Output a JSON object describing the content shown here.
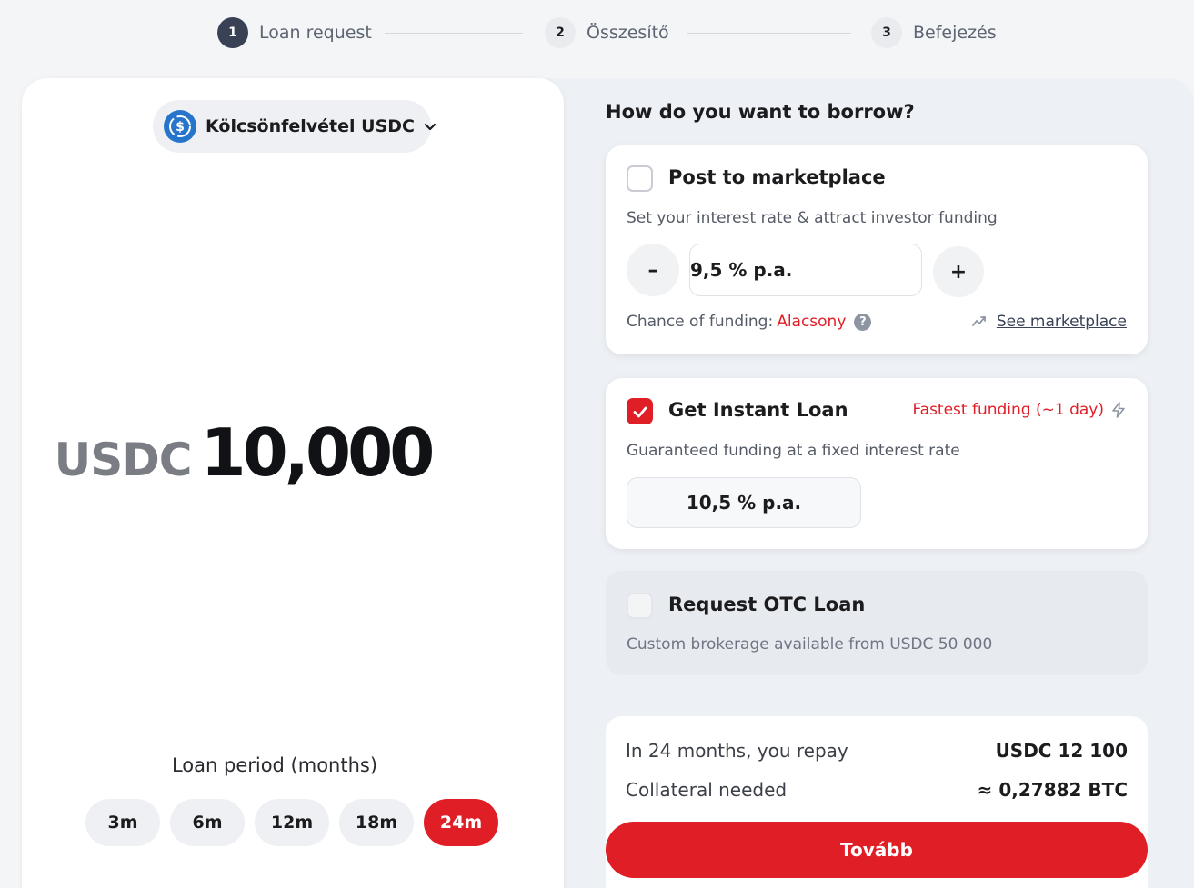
{
  "stepper": {
    "steps": [
      {
        "number": "1",
        "label": "Loan request"
      },
      {
        "number": "2",
        "label": "Összesítő"
      },
      {
        "number": "3",
        "label": "Befejezés"
      }
    ]
  },
  "asset": {
    "label": "Kölcsönfelvétel USDC",
    "icon": "usdc-icon"
  },
  "amount": {
    "currency": "USDC",
    "value": "10,000"
  },
  "period": {
    "label": "Loan period (months)",
    "options": [
      "3m",
      "6m",
      "12m",
      "18m",
      "24m"
    ],
    "selected": "24m"
  },
  "question": "How do you want to borrow?",
  "marketplace": {
    "title": "Post to marketplace",
    "checked": false,
    "description": "Set your interest rate & attract investor funding",
    "decrement": "–",
    "increment": "+",
    "rate": "9,5 % p.a.",
    "chance_label": "Chance of funding:",
    "chance_value": "Alacsony",
    "help": "?",
    "link": "See marketplace"
  },
  "instant": {
    "title": "Get Instant Loan",
    "checked": true,
    "badge": "Fastest funding (~1 day)",
    "description": "Guaranteed funding at a fixed interest rate",
    "rate": "10,5 % p.a."
  },
  "otc": {
    "title": "Request OTC Loan",
    "checked": false,
    "description": "Custom brokerage available from USDC 50 000"
  },
  "summary": {
    "repay_label": "In 24 months, you repay",
    "repay_value": "USDC 12 100",
    "collateral_label": "Collateral needed",
    "collateral_value": "≈ 0,27882 BTC"
  },
  "cta": "Tovább",
  "colors": {
    "accent": "#e01e26",
    "step_active": "#394155",
    "usdc_blue": "#2775ca"
  }
}
